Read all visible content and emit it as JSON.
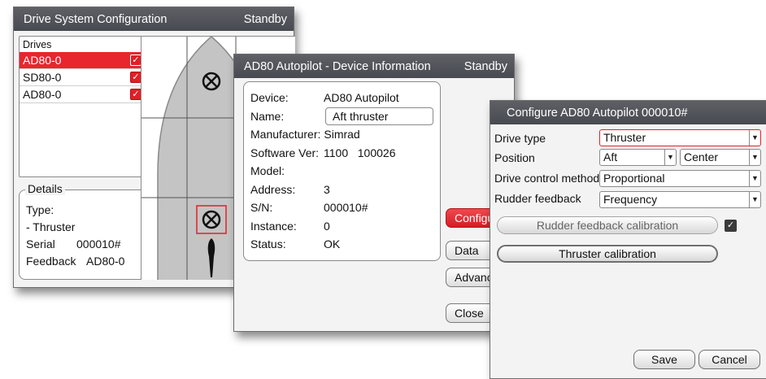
{
  "drive_config": {
    "title": "Drive System Configuration",
    "status": "Standby",
    "drives_header": "Drives",
    "drives": [
      {
        "name": "AD80-0",
        "selected": true
      },
      {
        "name": "SD80-0",
        "selected": false
      },
      {
        "name": "AD80-0",
        "selected": false
      }
    ],
    "details": {
      "legend": "Details",
      "type_label": "Type:",
      "type_value": " - Thruster",
      "serial_label": "Serial",
      "serial_value": "000010#",
      "feedback_label": "Feedback",
      "feedback_value": "AD80-0"
    }
  },
  "device_info": {
    "title": "AD80 Autopilot - Device Information",
    "status": "Standby",
    "rows": [
      {
        "key": "Device:",
        "value": "AD80 Autopilot"
      },
      {
        "key": "Name:",
        "value": "Aft thruster"
      },
      {
        "key": "Manufacturer:",
        "value": "Simrad"
      },
      {
        "key": "Software Ver:",
        "value": "1100   100026"
      },
      {
        "key": "Model:",
        "value": ""
      },
      {
        "key": "Address:",
        "value": "3"
      },
      {
        "key": "S/N:",
        "value": "000010#"
      },
      {
        "key": "Instance:",
        "value": "0"
      },
      {
        "key": "Status:",
        "value": "OK"
      }
    ],
    "buttons": {
      "configure": "Configure",
      "data": "Data",
      "advanced": "Advanced",
      "close": "Close"
    }
  },
  "configure": {
    "title": "Configure AD80 Autopilot 000010#",
    "drive_type_label": "Drive type",
    "drive_type_value": "Thruster",
    "position_label": "Position",
    "position_value_1": "Aft",
    "position_value_2": "Center",
    "control_method_label": "Drive control method",
    "control_method_value": "Proportional",
    "rudder_feedback_label": "Rudder feedback",
    "rudder_feedback_value": "Frequency",
    "rudder_calibration_label": "Rudder feedback calibration",
    "rudder_calibration_checked": true,
    "thruster_calibration_label": "Thruster calibration",
    "save_label": "Save",
    "cancel_label": "Cancel"
  },
  "colors": {
    "accent_red": "#e8262d",
    "titlebar": "#4e5157",
    "hull": "#c4c4c4"
  }
}
